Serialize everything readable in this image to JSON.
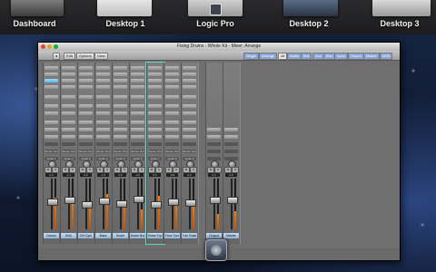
{
  "spaces": [
    {
      "label": "Dashboard"
    },
    {
      "label": "Desktop 1"
    },
    {
      "label": "Logic Pro"
    },
    {
      "label": "Desktop 2"
    },
    {
      "label": "Desktop 3"
    }
  ],
  "window": {
    "title": "Fixing Drums - Whole Kit - Mixer: Arrange"
  },
  "toolbar": {
    "edit": "Edit",
    "options": "Options",
    "view": "View",
    "view_buttons": [
      "Single",
      "Arrange",
      "All",
      "Audio",
      "Inst",
      "Aux",
      "Bus",
      "Input",
      "Output",
      "Master",
      "MIDI"
    ]
  },
  "channels": [
    {
      "name": "Drums",
      "db": "0.0",
      "output": "Stereo Out",
      "input": "Audio 1"
    },
    {
      "name": "Kick",
      "db": "-2.1",
      "output": "Stereo Out",
      "input": "Audio 2"
    },
    {
      "name": "OH Cym",
      "db": "0.0",
      "output": "Stereo Out",
      "input": "Audio 3"
    },
    {
      "name": "Bass",
      "db": "-1.5",
      "output": "Stereo Out",
      "input": "Audio 4"
    },
    {
      "name": "Snare",
      "db": "0.0",
      "output": "Stereo Out",
      "input": "Audio 5"
    },
    {
      "name": "Snare Bot",
      "db": "-3.2",
      "output": "Stereo Out",
      "input": "Audio 6"
    },
    {
      "name": "Snare Top",
      "db": "0.0",
      "output": "Stereo Out",
      "input": "Audio 7"
    },
    {
      "name": "Floor Tom",
      "db": "-0.8",
      "output": "Stereo Out",
      "input": "Audio 8"
    },
    {
      "name": "Tom Rack",
      "db": "0.0",
      "output": "Stereo Out",
      "input": "Audio 9"
    },
    {
      "name": "Output",
      "db": "0.0",
      "output": "",
      "input": ""
    },
    {
      "name": "Master",
      "db": "0.0",
      "output": "",
      "input": ""
    }
  ],
  "colors": {
    "accent_blue": "#58b4ea",
    "meter_orange": "#ff7a00",
    "selected_outline": "#5fd6c9"
  }
}
